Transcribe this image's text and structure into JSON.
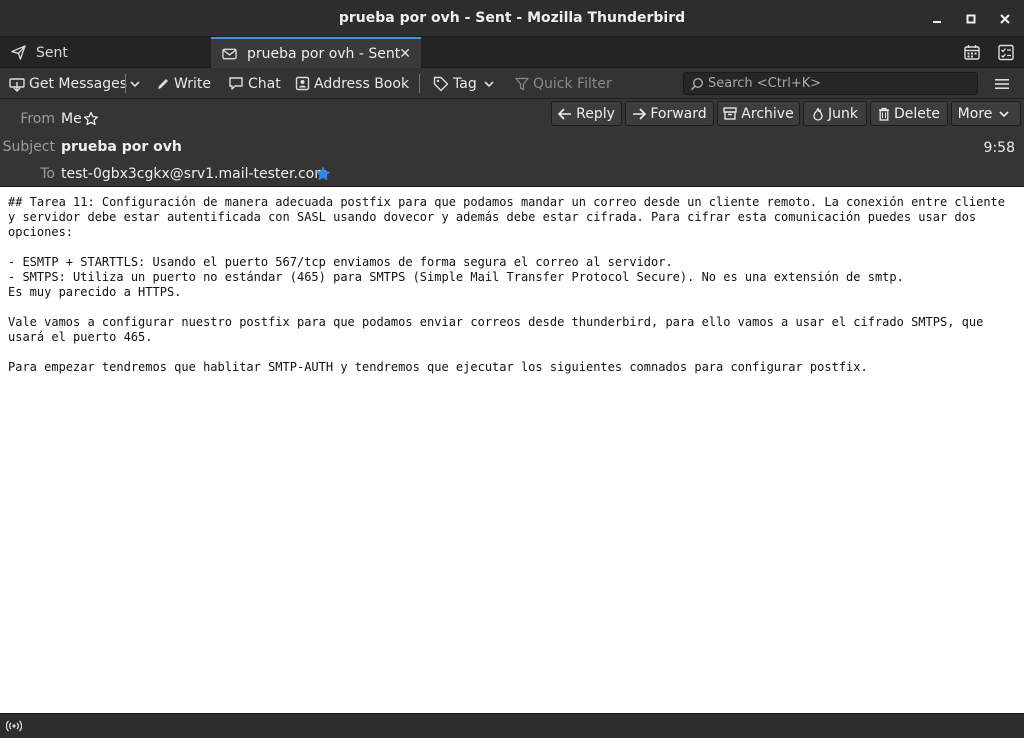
{
  "window": {
    "title": "prueba por ovh - Sent - Mozilla Thunderbird",
    "min_label": "—",
    "max_label": "□",
    "close_label": "✕"
  },
  "tabs": [
    {
      "label": "Sent",
      "icon": "send-icon"
    },
    {
      "label": "prueba por ovh - Sent",
      "icon": "envelope-icon",
      "close": "✕"
    }
  ],
  "toolbar": {
    "get_messages": "Get Messages",
    "write": "Write",
    "chat": "Chat",
    "address_book": "Address Book",
    "tag": "Tag",
    "quick_filter": "Quick Filter",
    "search_placeholder": "Search <Ctrl+K>"
  },
  "header": {
    "from_label": "From",
    "from_value": "Me",
    "subject_label": "Subject",
    "subject_value": "prueba por ovh",
    "to_label": "To",
    "to_value": "test-0gbx3cgkx@srv1.mail-tester.com",
    "time": "9:58",
    "buttons": {
      "reply": "Reply",
      "forward": "Forward",
      "archive": "Archive",
      "junk": "Junk",
      "delete": "Delete",
      "more": "More"
    }
  },
  "body": {
    "text": "## Tarea 11: Configuración de manera adecuada postfix para que podamos mandar un correo desde un cliente remoto. La conexión entre cliente y servidor debe estar autentificada con SASL usando dovecor y además debe estar cifrada. Para cifrar esta comunicación puedes usar dos opciones:\n\n- ESMTP + STARTTLS: Usando el puerto 567/tcp enviamos de forma segura el correo al servidor.\n- SMTPS: Utiliza un puerto no estándar (465) para SMTPS (Simple Mail Transfer Protocol Secure). No es una extensión de smtp.\nEs muy parecido a HTTPS.\n\nVale vamos a configurar nuestro postfix para que podamos enviar correos desde thunderbird, para ello vamos a usar el cifrado SMTPS, que usará el puerto 465.\n\nPara empezar tendremos que hablitar SMTP-AUTH y tendremos que ejecutar los siguientes comnados para configurar postfix."
  },
  "colors": {
    "accent": "#4a90d9",
    "star_blue": "#3584e4"
  }
}
